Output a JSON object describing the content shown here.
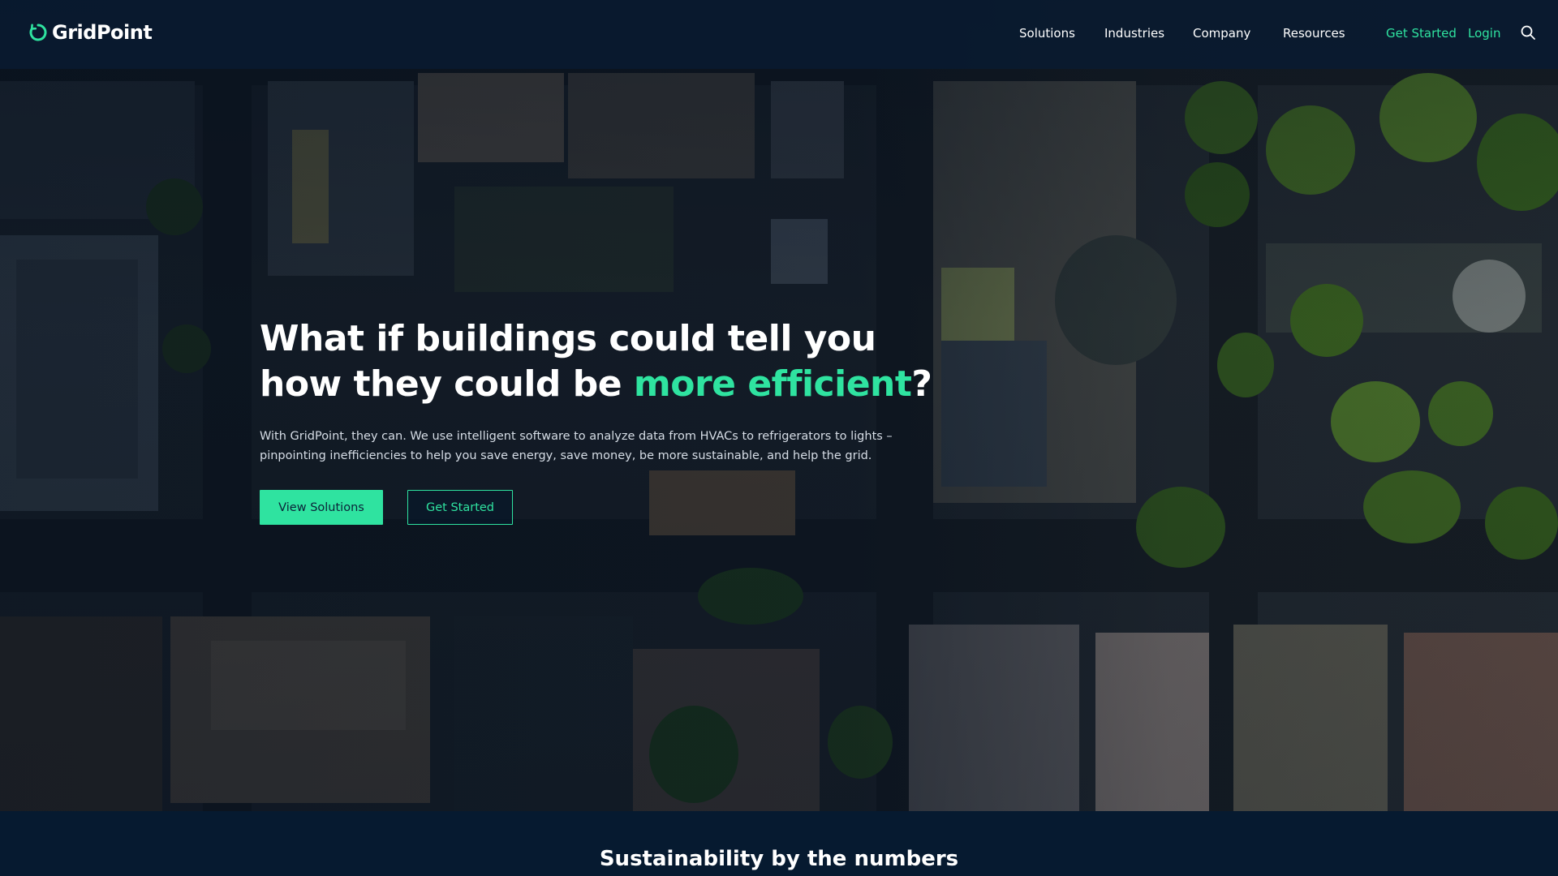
{
  "brand": {
    "name": "GridPoint",
    "accent": "#2fe3a0",
    "navy": "#061a30"
  },
  "nav": {
    "links": [
      "Solutions",
      "Industries",
      "Company",
      "Resources"
    ],
    "get_started": "Get Started",
    "login": "Login",
    "search_icon": "search-icon"
  },
  "hero": {
    "headline_part1": "What if buildings could tell you how they could be ",
    "headline_accent": "more efficient",
    "headline_end": "?",
    "subtext": "With GridPoint, they can. We use intelligent software to analyze data from HVACs to refrigerators to lights – pinpointing inefficiencies to help you save energy, save money, be more sustainable, and help the grid.",
    "primary_button": "View Solutions",
    "secondary_button": "Get Started"
  },
  "numbers_section": {
    "title": "Sustainability by the numbers"
  }
}
